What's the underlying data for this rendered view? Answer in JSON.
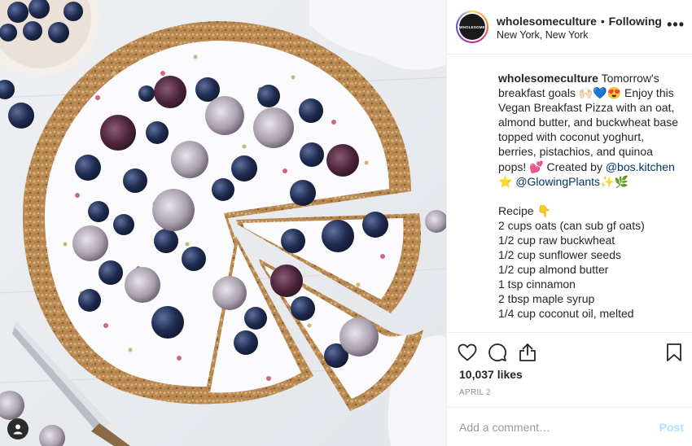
{
  "photo": {
    "subject": "vegan breakfast pizza with coconut yoghurt and berries",
    "user_tag_icon": "person-icon"
  },
  "header": {
    "avatar_text": "WHOLESOME",
    "username": "wholesomeculture",
    "separator": "•",
    "follow_state": "Following",
    "location": "New York, New York",
    "more_icon": "more-horizontal-icon",
    "more_label": "•••"
  },
  "caption": {
    "username": "wholesomeculture",
    "text_1": "Tomorrow's breakfast goals 🙌🏻💙😍 Enjoy this Vegan Breakfast Pizza with an oat, almond butter, and buckwheat base topped with coconut yoghurt, berries, pistachios, and quinoa pops! 💕 Created by ",
    "mention_1": "@bos.kitchen",
    "text_2": " ⭐ ",
    "mention_2": "@GlowingPlants",
    "text_3": "✨🌿",
    "recipe_title": "Recipe 👇",
    "recipe_lines": [
      "2 cups oats (can sub gf oats)",
      "1/2 cup raw buckwheat",
      "1/2 cup sunflower seeds",
      "1/2 cup almond butter",
      "1 tsp cinnamon",
      "2 tbsp maple syrup",
      "1/4 cup coconut oil, melted"
    ]
  },
  "actions": {
    "like_icon": "heart-icon",
    "comment_icon": "comment-bubble-icon",
    "share_icon": "share-icon",
    "save_icon": "bookmark-icon",
    "likes": "10,037 likes",
    "date": "APRIL 2"
  },
  "comment": {
    "placeholder": "Add a comment…",
    "post_label": "Post"
  },
  "colors": {
    "text": "#262626",
    "muted": "#8e8e8e",
    "link": "#003569",
    "post_disabled": "#b2dffc",
    "border": "#efefef"
  }
}
